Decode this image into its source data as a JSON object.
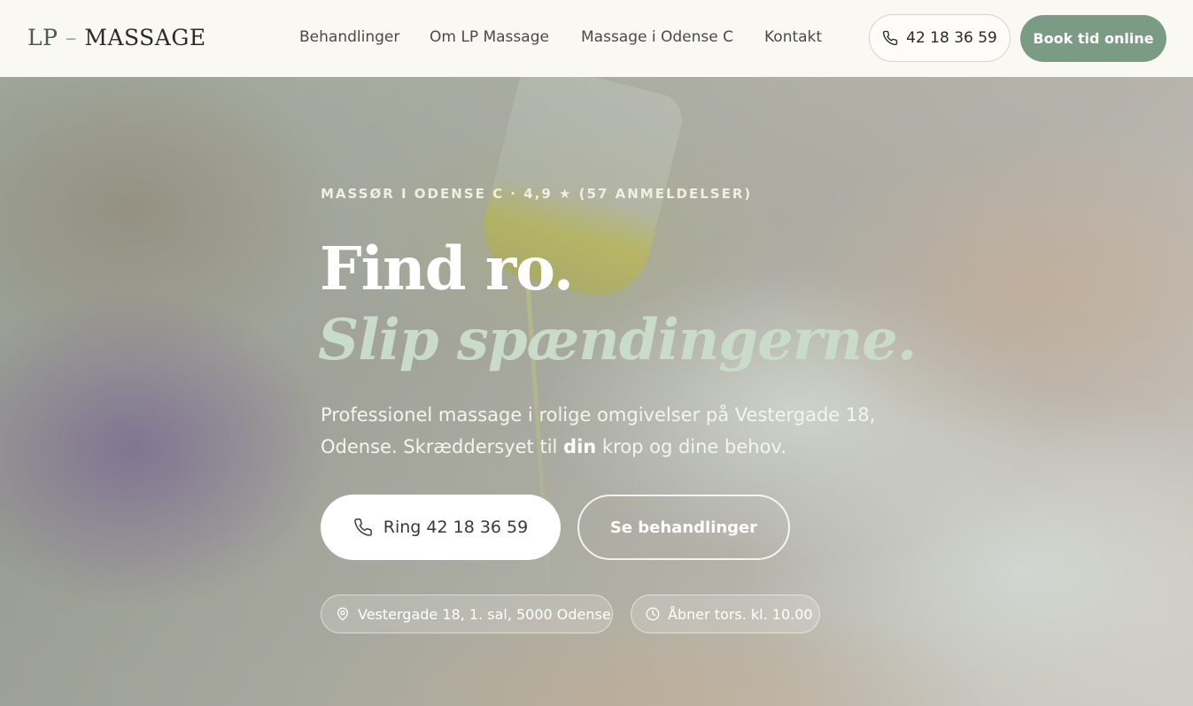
{
  "header": {
    "logo_lp": "LP",
    "logo_dash": "–",
    "logo_massage": "MASSAGE",
    "nav": [
      {
        "label": "Behandlinger"
      },
      {
        "label": "Om LP Massage"
      },
      {
        "label": "Massage i Odense C"
      },
      {
        "label": "Kontakt"
      }
    ],
    "phone": "42 18 36 59",
    "book_label": "Book tid online"
  },
  "hero": {
    "eyebrow": "MASSØR I ODENSE C · 4,9 ★ (57 ANMELDELSER)",
    "headline_1": "Find ro.",
    "headline_2": "Slip spændingerne.",
    "intro_part1": "Professionel massage i rolige omgivelser på Vestergade 18, Odense. Skræddersyet til ",
    "intro_bold": "din",
    "intro_part2": " krop og dine behov.",
    "cta_call": "Ring 42 18 36 59",
    "cta_treatments": "Se behandlinger",
    "address": "Vestergade 18, 1. sal, 5000 Odense",
    "hours": "Åbner tors. kl. 10.00"
  },
  "colors": {
    "accent": "#7b9c84",
    "background": "#faf8f3",
    "headline_italic": "#c9dcc9"
  },
  "icons": [
    "phone-icon",
    "map-pin-icon",
    "clock-icon"
  ]
}
